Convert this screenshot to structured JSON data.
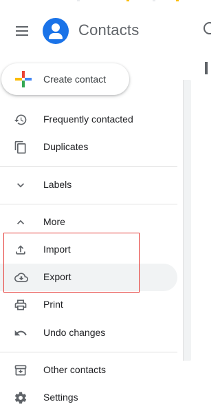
{
  "app": {
    "title": "Contacts",
    "accent_color": "#1a73e8"
  },
  "header": {
    "menu_icon": "hamburger-menu-icon",
    "logo_icon": "contacts-person-icon"
  },
  "create": {
    "label": "Create contact",
    "icon": "multicolor-plus-icon"
  },
  "nav": {
    "frequently_contacted": {
      "label": "Frequently contacted",
      "icon": "history-icon"
    },
    "duplicates": {
      "label": "Duplicates",
      "icon": "copy-icon"
    },
    "labels": {
      "label": "Labels",
      "icon": "chevron-down-icon"
    },
    "more": {
      "label": "More",
      "icon": "chevron-up-icon"
    },
    "import": {
      "label": "Import",
      "icon": "upload-icon"
    },
    "export": {
      "label": "Export",
      "icon": "cloud-download-icon"
    },
    "print": {
      "label": "Print",
      "icon": "printer-icon"
    },
    "undo": {
      "label": "Undo changes",
      "icon": "undo-icon"
    },
    "other_contacts": {
      "label": "Other contacts",
      "icon": "archive-icon"
    },
    "settings": {
      "label": "Settings",
      "icon": "gear-icon"
    }
  },
  "annotation": {
    "highlight_color": "#e53935"
  }
}
